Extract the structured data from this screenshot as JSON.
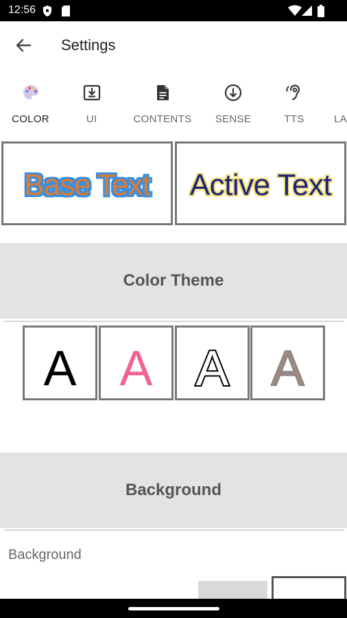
{
  "status_bar": {
    "time": "12:56",
    "icons": [
      "shield-icon",
      "sd-card-icon",
      "wifi-icon",
      "signal-icon",
      "battery-icon"
    ]
  },
  "app_bar": {
    "back_icon": "arrow-back-icon",
    "title": "Settings"
  },
  "tabs": [
    {
      "label": "COLOR",
      "icon": "palette-icon",
      "active": true
    },
    {
      "label": "UI",
      "icon": "download-box-icon",
      "active": false
    },
    {
      "label": "CONTENTS",
      "icon": "document-icon",
      "active": false
    },
    {
      "label": "SENSE",
      "icon": "arrow-circle-down-icon",
      "active": false
    },
    {
      "label": "TTS",
      "icon": "hearing-icon",
      "active": false
    },
    {
      "label": "LA",
      "icon": "",
      "active": false
    }
  ],
  "preview": {
    "base_text": "Base Text",
    "active_text": "Active Text",
    "base_fill": "#e07a2e",
    "base_outline": "#3a8fe0",
    "active_fill": "#1a237e",
    "active_outline": "#f6e07a"
  },
  "sections": {
    "color_theme": "Color Theme",
    "background": "Background"
  },
  "theme_samples": [
    {
      "letter": "A",
      "fill": "#000000",
      "stroke": "none"
    },
    {
      "letter": "A",
      "fill": "#f06292",
      "stroke": "none"
    },
    {
      "letter": "A",
      "fill": "#ffffff",
      "stroke": "#000000"
    },
    {
      "letter": "A",
      "fill": "#a1887f",
      "stroke": "#607d8b"
    }
  ],
  "background_row": {
    "label": "Background",
    "swatches": [
      "#d9d9d9",
      "#ffffff"
    ]
  }
}
